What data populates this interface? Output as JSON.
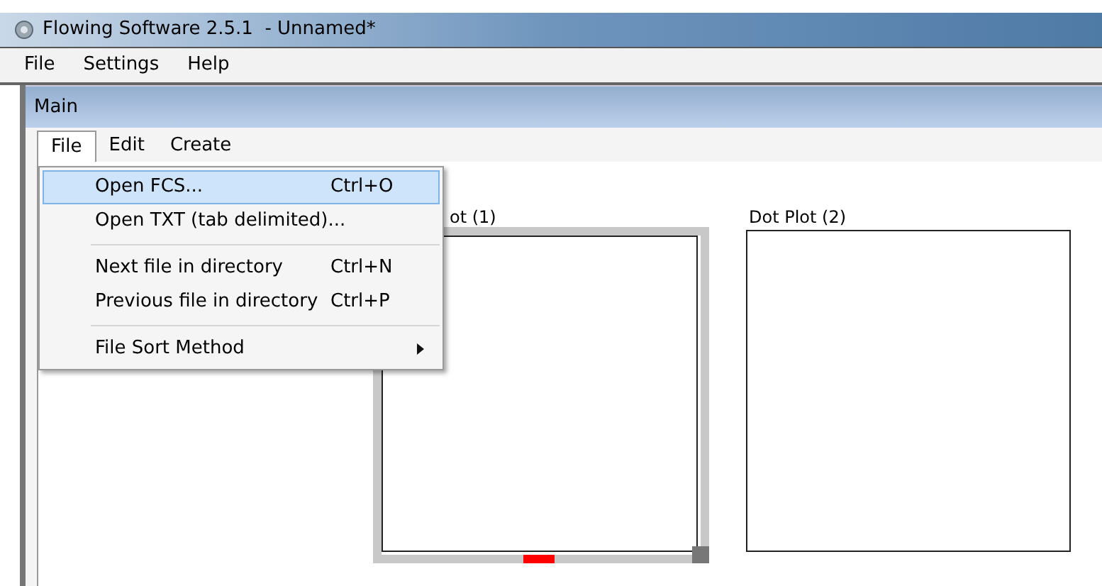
{
  "window": {
    "title": "Flowing Software 2.5.1  - Unnamed*"
  },
  "menubar": [
    "File",
    "Settings",
    "Help"
  ],
  "inner_window": {
    "title": "Main"
  },
  "tabs": [
    {
      "label": "File",
      "selected": true
    },
    {
      "label": "Edit",
      "selected": false
    },
    {
      "label": "Create",
      "selected": false
    }
  ],
  "file_menu": [
    {
      "kind": "item",
      "label": "Open FCS...",
      "shortcut": "Ctrl+O",
      "selected": true
    },
    {
      "kind": "item",
      "label": "Open TXT (tab delimited)...",
      "selected": false
    },
    {
      "kind": "separator"
    },
    {
      "kind": "item",
      "label": "Next file in directory",
      "shortcut": "Ctrl+N",
      "selected": false
    },
    {
      "kind": "item",
      "label": "Previous file in directory",
      "shortcut": "Ctrl+P",
      "selected": false
    },
    {
      "kind": "separator"
    },
    {
      "kind": "submenu",
      "label": "File Sort Method",
      "selected": false
    }
  ],
  "plots": [
    {
      "title": "ot (1)",
      "selected": true
    },
    {
      "title": "Dot Plot (2)",
      "selected": false
    }
  ]
}
